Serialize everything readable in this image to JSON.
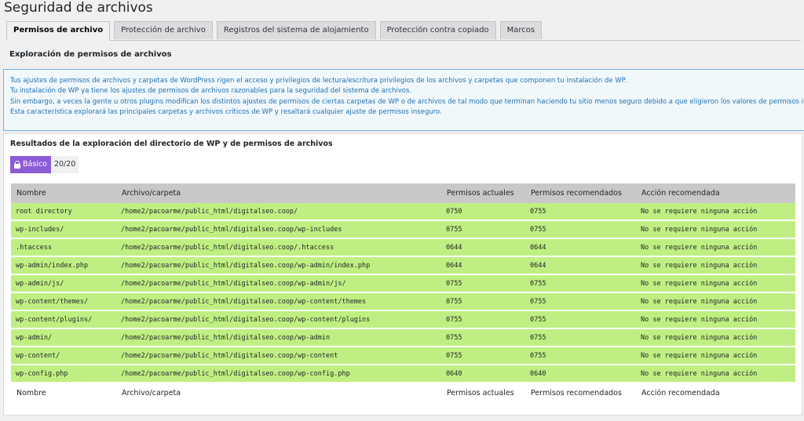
{
  "page": {
    "title": "Seguridad de archivos"
  },
  "tabs": [
    {
      "label": "Permisos de archivo",
      "active": true
    },
    {
      "label": "Protección de archivo",
      "active": false
    },
    {
      "label": "Registros del sistema de alojamiento",
      "active": false
    },
    {
      "label": "Protección contra copiado",
      "active": false
    },
    {
      "label": "Marcos",
      "active": false
    }
  ],
  "section": {
    "title": "Exploración de permisos de archivos"
  },
  "info": {
    "lines": [
      "Tus ajustes de permisos de archivos y carpetas de WordPress rigen el acceso y privilegios de lectura/escritura privilegios de los archivos y carpetas que componen tu instalación de WP.",
      "Tu instalación de WP ya tiene los ajustes de permisos de archivos razonables para la seguridad del sistema de archivos.",
      "Sin embargo, a veces la gente u otros plugins modifican los distintos ajustes de permisos de ciertas carpetas de WP o de archivos de tal modo que terminan haciendo tu sitio menos seguro debido a que eligieron los valores de permisos incorrectos.",
      "Esta característica explorará las principales carpetas y archivos críticos de WP y resaltará cualquier ajuste de permisos inseguro."
    ]
  },
  "results": {
    "title": "Resultados de la exploración del directorio de WP y de permisos de archivos",
    "badge_level": "Básico",
    "badge_score": "20/20",
    "columns": [
      "Nombre",
      "Archivo/carpeta",
      "Permisos actuales",
      "Permisos recomendados",
      "Acción recomendada"
    ],
    "rows": [
      {
        "name": "root directory",
        "path": "/home2/pacoarme/public_html/digitalseo.coop/",
        "current": "0750",
        "recommended": "0755",
        "action": "No se requiere ninguna acción"
      },
      {
        "name": "wp-includes/",
        "path": "/home2/pacoarme/public_html/digitalseo.coop/wp-includes",
        "current": "0755",
        "recommended": "0755",
        "action": "No se requiere ninguna acción"
      },
      {
        "name": ".htaccess",
        "path": "/home2/pacoarme/public_html/digitalseo.coop/.htaccess",
        "current": "0644",
        "recommended": "0644",
        "action": "No se requiere ninguna acción"
      },
      {
        "name": "wp-admin/index.php",
        "path": "/home2/pacoarme/public_html/digitalseo.coop/wp-admin/index.php",
        "current": "0644",
        "recommended": "0644",
        "action": "No se requiere ninguna acción"
      },
      {
        "name": "wp-admin/js/",
        "path": "/home2/pacoarme/public_html/digitalseo.coop/wp-admin/js/",
        "current": "0755",
        "recommended": "0755",
        "action": "No se requiere ninguna acción"
      },
      {
        "name": "wp-content/themes/",
        "path": "/home2/pacoarme/public_html/digitalseo.coop/wp-content/themes",
        "current": "0755",
        "recommended": "0755",
        "action": "No se requiere ninguna acción"
      },
      {
        "name": "wp-content/plugins/",
        "path": "/home2/pacoarme/public_html/digitalseo.coop/wp-content/plugins",
        "current": "0755",
        "recommended": "0755",
        "action": "No se requiere ninguna acción"
      },
      {
        "name": "wp-admin/",
        "path": "/home2/pacoarme/public_html/digitalseo.coop/wp-admin",
        "current": "0755",
        "recommended": "0755",
        "action": "No se requiere ninguna acción"
      },
      {
        "name": "wp-content/",
        "path": "/home2/pacoarme/public_html/digitalseo.coop/wp-content",
        "current": "0755",
        "recommended": "0755",
        "action": "No se requiere ninguna acción"
      },
      {
        "name": "wp-config.php",
        "path": "/home2/pacoarme/public_html/digitalseo.coop/wp-config.php",
        "current": "0640",
        "recommended": "0640",
        "action": "No se requiere ninguna acción"
      }
    ]
  },
  "colors": {
    "badge": "#8c5bd6",
    "ok_row": "#bfef82",
    "info_border": "#72aee6",
    "info_text": "#2271b1"
  },
  "icons": {
    "badge": "lock-icon"
  }
}
